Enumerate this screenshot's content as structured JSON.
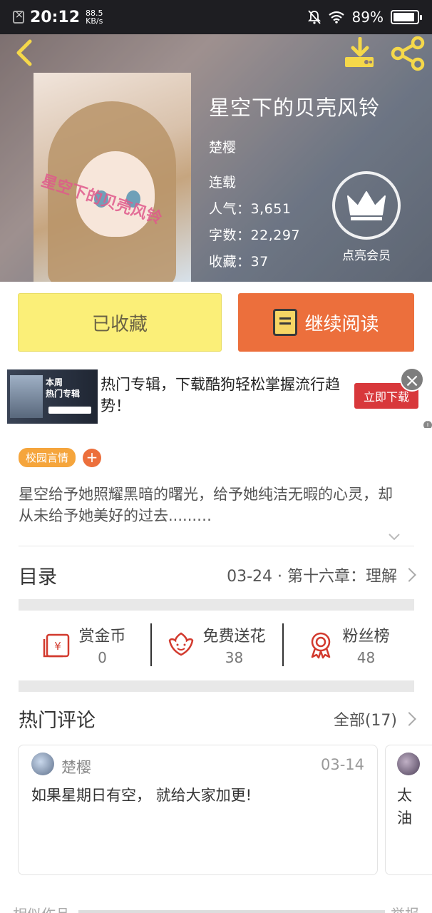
{
  "status_bar": {
    "time": "20:12",
    "speed_value": "88.5",
    "speed_unit": "KB/s",
    "battery": "89%"
  },
  "book": {
    "cover_text": "星空下的贝壳风铃",
    "title": "星空下的贝壳风铃",
    "author": "楚樱",
    "status": "连载",
    "popularity_label": "人气：",
    "popularity": "3,651",
    "words_label": "字数：",
    "words": "22,297",
    "favorites_label": "收藏：",
    "favorites": "37"
  },
  "vip": {
    "label": "点亮会员"
  },
  "actions": {
    "favorited_label": "已收藏",
    "continue_label": "继续阅读"
  },
  "ad": {
    "image_text": "本周\n热门专辑",
    "text": "热门专辑，下载酷狗轻松掌握流行趋势！",
    "button": "立即下载",
    "close": "×"
  },
  "tags": {
    "items": [
      "校园言情"
    ],
    "add": "+"
  },
  "description": "星空给予她照耀黑暗的曙光，给予她纯洁无暇的心灵，却从未给予她美好的过去......…",
  "toc": {
    "label": "目录",
    "latest": "03-24 · 第十六章：理解"
  },
  "stats": [
    {
      "name": "赏金币",
      "value": "0",
      "icon": "red-envelope-icon"
    },
    {
      "name": "免费送花",
      "value": "38",
      "icon": "flower-icon"
    },
    {
      "name": "粉丝榜",
      "value": "48",
      "icon": "medal-icon"
    }
  ],
  "comments": {
    "title": "热门评论",
    "all": "全部(17)",
    "items": [
      {
        "user": "楚樱",
        "date": "03-14",
        "text": "如果星期日有空， 就给大家加更!"
      },
      {
        "user": "",
        "date": "",
        "text": "太油"
      }
    ]
  },
  "footer": {
    "similar": "相似作品",
    "report": "举报"
  },
  "colors": {
    "favorite_bg": "#fbef78",
    "read_bg": "#ec6f3c",
    "tag_bg": "#f5a53c",
    "ad_button": "#d8383b"
  }
}
